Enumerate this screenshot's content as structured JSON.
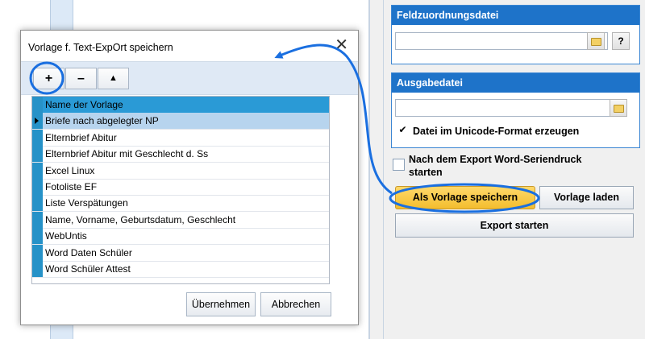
{
  "dialog": {
    "title": "Vorlage f. Text-ExpOrt speichern",
    "close_symbol": "✕",
    "toolbar": {
      "add": "+",
      "remove": "–",
      "up": "▲"
    },
    "list": {
      "header": "Name der Vorlage",
      "items": [
        "Briefe nach abgelegter NP",
        "Elternbrief Abitur",
        "Elternbrief Abitur mit Geschlecht d. Ss",
        "Excel Linux",
        "Fotoliste EF",
        "Liste Verspätungen",
        "Name, Vorname, Geburtsdatum, Geschlecht",
        "WebUntis",
        "Word Daten Schüler",
        "Word Schüler Attest"
      ],
      "selected_index": 0
    },
    "apply_button": "Übernehmen",
    "cancel_button": "Abbrechen"
  },
  "right_panel": {
    "mapping_group": {
      "title": "Feldzuordnungsdatei",
      "value": "",
      "help_label": "?"
    },
    "output_group": {
      "title": "Ausgabedatei",
      "value": "",
      "unicode_label": "Datei im Unicode-Format erzeugen",
      "unicode_checked": true
    },
    "word_merge_label_line1": "Nach dem Export Word-Seriendruck",
    "word_merge_label_line2": "starten",
    "save_template_button": "Als Vorlage speichern",
    "load_template_button": "Vorlage laden",
    "export_button": "Export starten"
  },
  "colors": {
    "group_header": "#1e73c9",
    "highlight_button": "#f6c840",
    "annotation": "#1a6fe0",
    "list_header": "#2a9ad6"
  }
}
